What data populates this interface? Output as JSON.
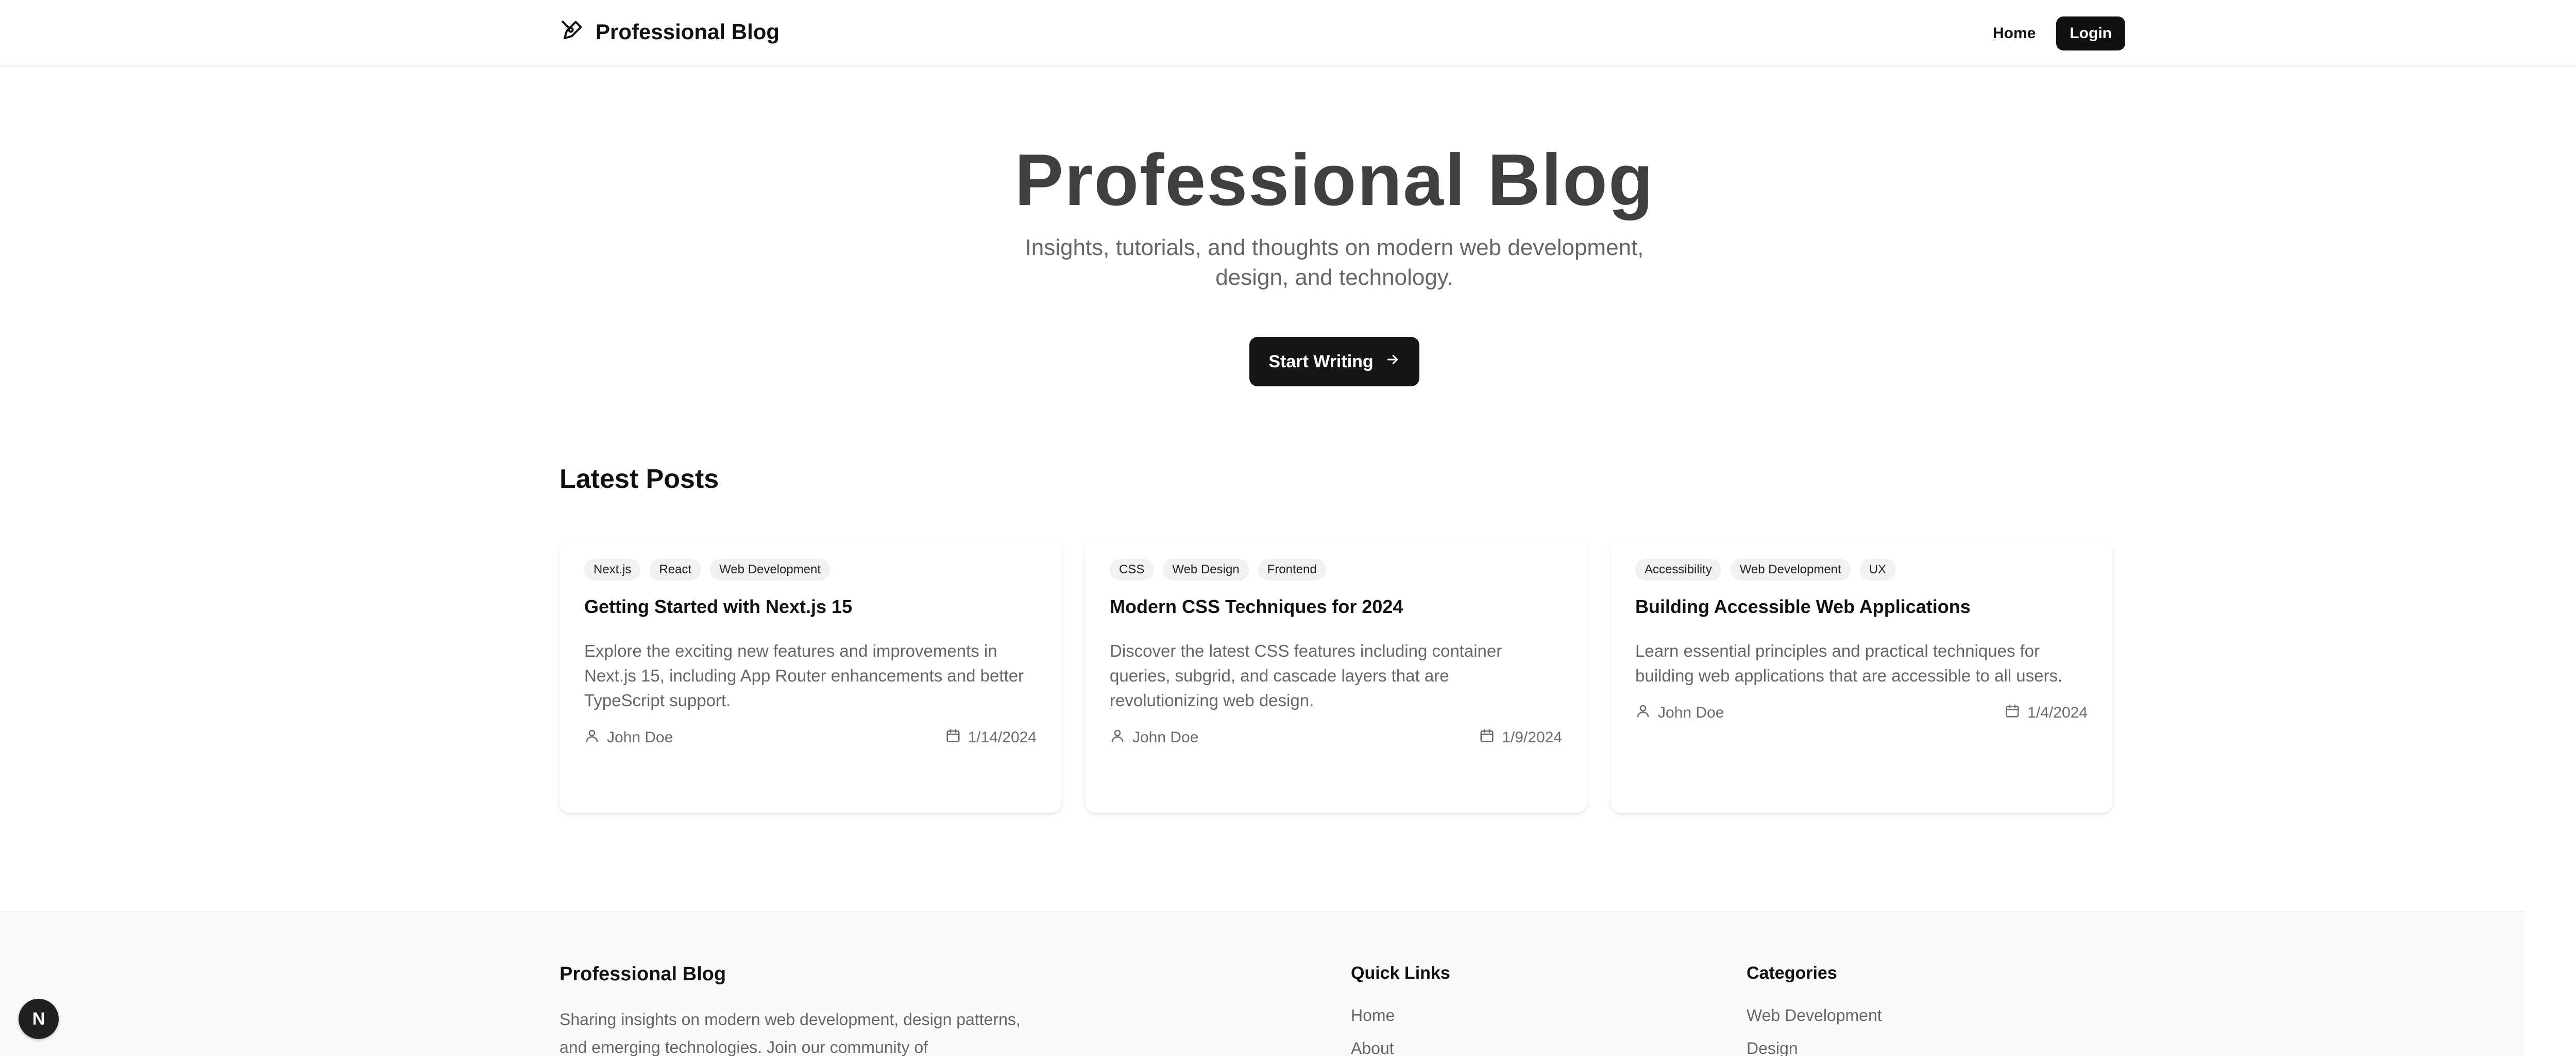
{
  "header": {
    "brand": "Professional Blog",
    "brand_icon": "pen-nib-icon",
    "nav": {
      "home": "Home",
      "login": "Login"
    }
  },
  "hero": {
    "title": "Professional Blog",
    "subtitle": "Insights, tutorials, and thoughts on modern web development, design, and technology.",
    "cta_label": "Start Writing",
    "cta_icon": "arrow-right-icon"
  },
  "latest": {
    "title": "Latest Posts",
    "posts": [
      {
        "tags": [
          "Next.js",
          "React",
          "Web Development"
        ],
        "title": "Getting Started with Next.js 15",
        "excerpt": "Explore the exciting new features and improvements in Next.js 15, including App Router enhancements and better TypeScript support.",
        "author": "John Doe",
        "date": "1/14/2024"
      },
      {
        "tags": [
          "CSS",
          "Web Design",
          "Frontend"
        ],
        "title": "Modern CSS Techniques for 2024",
        "excerpt": "Discover the latest CSS features including container queries, subgrid, and cascade layers that are revolutionizing web design.",
        "author": "John Doe",
        "date": "1/9/2024"
      },
      {
        "tags": [
          "Accessibility",
          "Web Development",
          "UX"
        ],
        "title": "Building Accessible Web Applications",
        "excerpt": "Learn essential principles and practical techniques for building web applications that are accessible to all users.",
        "author": "John Doe",
        "date": "1/4/2024"
      }
    ]
  },
  "footer": {
    "brand": "Professional Blog",
    "about": "Sharing insights on modern web development, design patterns, and emerging technologies. Join our community of",
    "quick_links": {
      "title": "Quick Links",
      "items": [
        "Home",
        "About"
      ]
    },
    "categories": {
      "title": "Categories",
      "items": [
        "Web Development",
        "Design"
      ]
    }
  },
  "dev_badge": "N",
  "colors": {
    "primary": "#111111",
    "muted": "#666666",
    "tag_bg": "#f1f1f1"
  }
}
